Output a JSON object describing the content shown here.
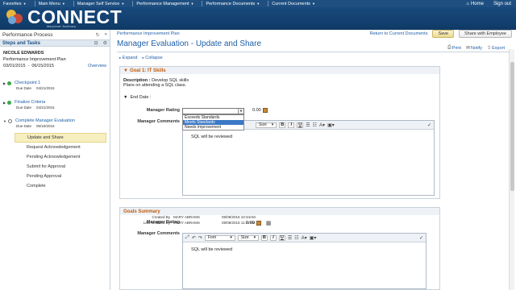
{
  "topnav": {
    "items": [
      {
        "label": "Favorites"
      },
      {
        "label": "Main Menu"
      },
      {
        "label": "Manager Self Service"
      },
      {
        "label": "Performance Management"
      },
      {
        "label": "Performance Documents"
      },
      {
        "label": "Current Documents"
      }
    ],
    "home": "Home",
    "signout": "Sign out"
  },
  "header": {
    "logo": "CONNECT",
    "logo_sub": "Maryland Judiciary"
  },
  "left": {
    "panel_title": "Performance Process",
    "steps_title": "Steps and Tasks",
    "employee_name": "NICOLE EDWARDS",
    "plan": "Performance Improvement Plan",
    "start": "03/01/2015",
    "dash": "-",
    "end": "06/15/2015",
    "overview": "Overview",
    "steps": [
      {
        "title": "Checkpoint 1",
        "due_label": "Due Date",
        "due": "04/21/2015",
        "status": "complete"
      },
      {
        "title": "Finalize Criteria",
        "due_label": "Due Date",
        "due": "04/21/2015",
        "status": "complete"
      },
      {
        "title": "Complete Manager Evaluation",
        "due_label": "Due Date",
        "due": "06/15/2015",
        "status": "in-progress"
      }
    ],
    "substeps": [
      {
        "label": "Update and Share",
        "active": true
      },
      {
        "label": "Request Acknowledgement"
      },
      {
        "label": "Pending Acknowledgement"
      },
      {
        "label": "Submit for Approval"
      },
      {
        "label": "Pending Approval"
      },
      {
        "label": "Complete"
      }
    ]
  },
  "main": {
    "crumb": "Performance Improvement Plan",
    "return_link": "Return to Current Documents",
    "save": "Save",
    "share": "Share with Employee",
    "title": "Manager Evaluation - Update and Share",
    "print": "Print",
    "notify": "Notify",
    "export": "Export",
    "expand": "Expand",
    "collapse": "Collapse",
    "goal_title": "Goal 1: IT Skills",
    "description_label": "Description :",
    "description_line1": "Develop SQL skills",
    "description_line2": "Plans on attending a SQL class.",
    "end_date_label": "End Date :",
    "manager_rating_label": "Manager Rating",
    "manager_comments_label": "Manager Comments",
    "rating_options": [
      "Exceeds Standards",
      "Meets Standards",
      "Needs Improvement"
    ],
    "rating_selected": "Meets Standards",
    "score": "0.00",
    "toolbar": {
      "font": "Font",
      "size": "Size",
      "bold": "B",
      "italic": "I",
      "underline": "U",
      "color": "A"
    },
    "comment_text": "SQL will be reviewed",
    "created_by_label": "Created By",
    "created_by": "MARY ABRAMS",
    "created_on": "09/08/2015 10:34AM",
    "modified_by_label": "Last Modified By",
    "modified_by": "MARY ABRAMS",
    "modified_on": "09/08/2015 11:17AM",
    "summary_title": "Goals Summary",
    "summary_score": "0.00",
    "summary_comment": "SQL will be reviewed"
  }
}
